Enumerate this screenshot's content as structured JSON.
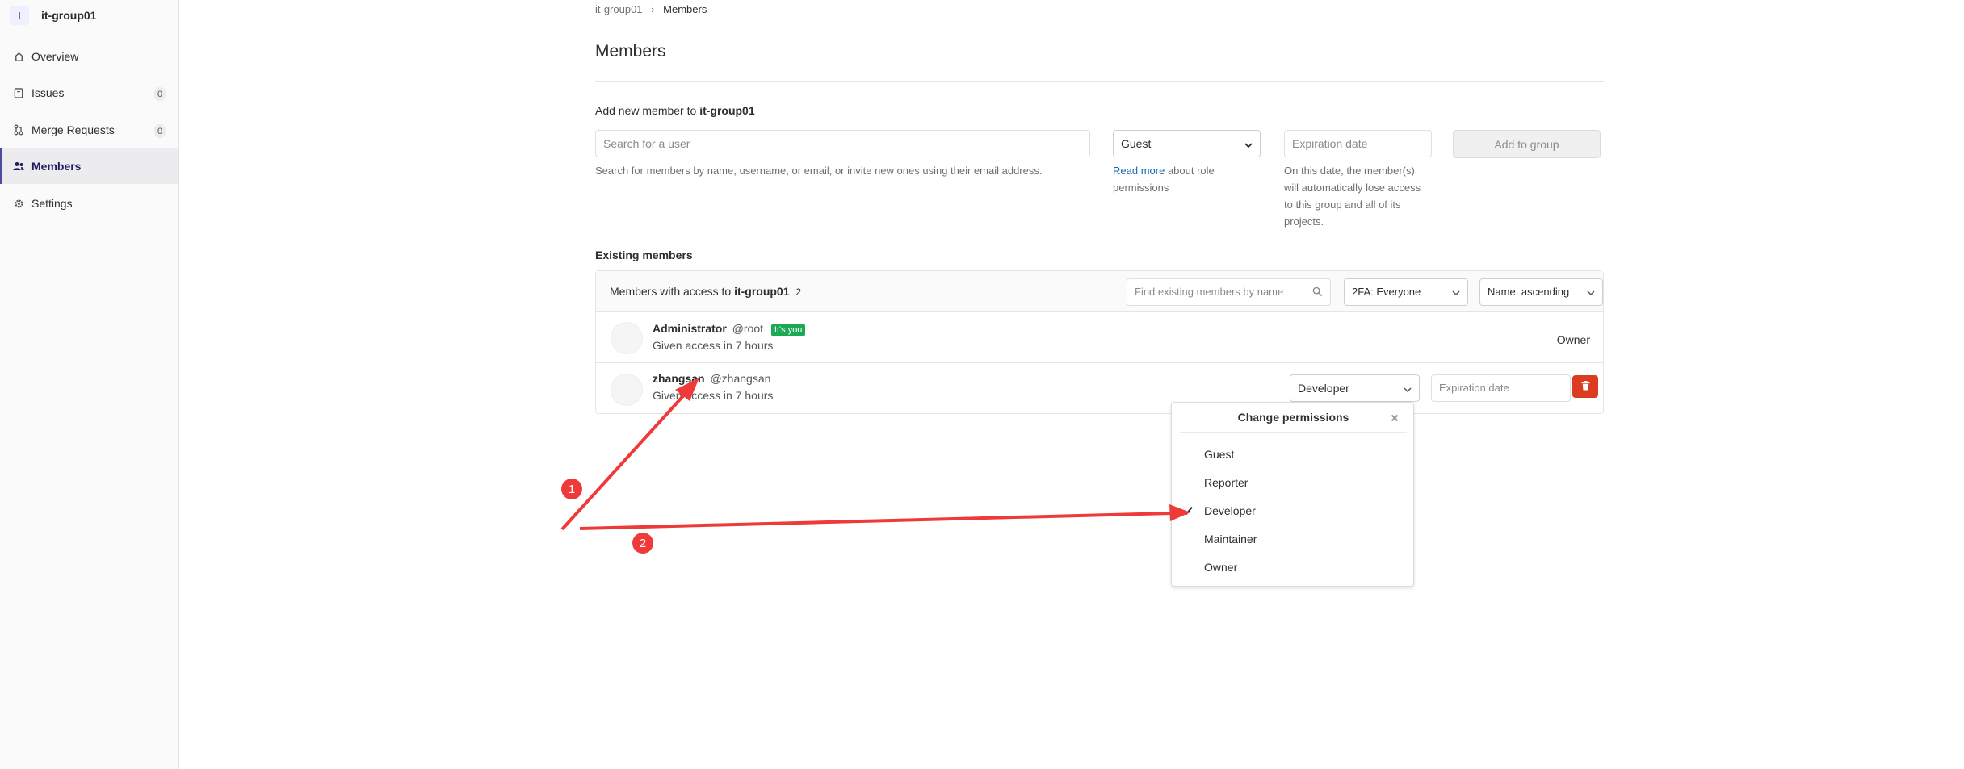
{
  "sidebar": {
    "avatar_letter": "I",
    "title": "it-group01",
    "items": [
      {
        "label": "Overview",
        "icon": "home-icon"
      },
      {
        "label": "Issues",
        "icon": "issues-icon",
        "count": "0"
      },
      {
        "label": "Merge Requests",
        "icon": "merge-request-icon",
        "count": "0"
      },
      {
        "label": "Members",
        "icon": "users-icon",
        "active": true
      },
      {
        "label": "Settings",
        "icon": "gear-icon"
      }
    ]
  },
  "breadcrumb": {
    "group": "it-group01",
    "current": "Members"
  },
  "page_title": "Members",
  "add_member": {
    "label_prefix": "Add new member to",
    "group": "it-group01",
    "search_placeholder": "Search for a user",
    "search_help": "Search for members by name, username, or email, or invite new ones using their email address.",
    "role_selected": "Guest",
    "read_more": "Read more",
    "read_more_rest": "about role",
    "read_more_rest2": "permissions",
    "expiration_placeholder": "Expiration date",
    "expiration_help": [
      "On this date, the member(s)",
      "will automatically lose access",
      "to this group and all of its",
      "projects."
    ],
    "add_button": "Add to group"
  },
  "existing": {
    "title": "Existing members",
    "header_prefix": "Members with access to",
    "group": "it-group01",
    "count": "2",
    "filter_placeholder": "Find existing members by name",
    "twofa_selected": "2FA: Everyone",
    "sort_selected": "Name, ascending",
    "members": [
      {
        "name": "Administrator",
        "username": "@root",
        "badge": "It's you",
        "given": "Given access in 7 hours",
        "role": "Owner"
      },
      {
        "name": "zhangsan",
        "username": "@zhangsan",
        "given": "Given access in 7 hours",
        "role": "Developer",
        "expiration_placeholder": "Expiration date"
      }
    ]
  },
  "permissions_dropdown": {
    "title": "Change permissions",
    "options": [
      "Guest",
      "Reporter",
      "Developer",
      "Maintainer",
      "Owner"
    ],
    "selected": "Developer"
  },
  "annotations": {
    "marker1": "1",
    "marker2": "2",
    "color": "#ef3a3a"
  },
  "colors": {
    "accent": "#4b4ba3",
    "link": "#1b69b6",
    "success": "#1aaa55",
    "danger": "#db3b21"
  }
}
